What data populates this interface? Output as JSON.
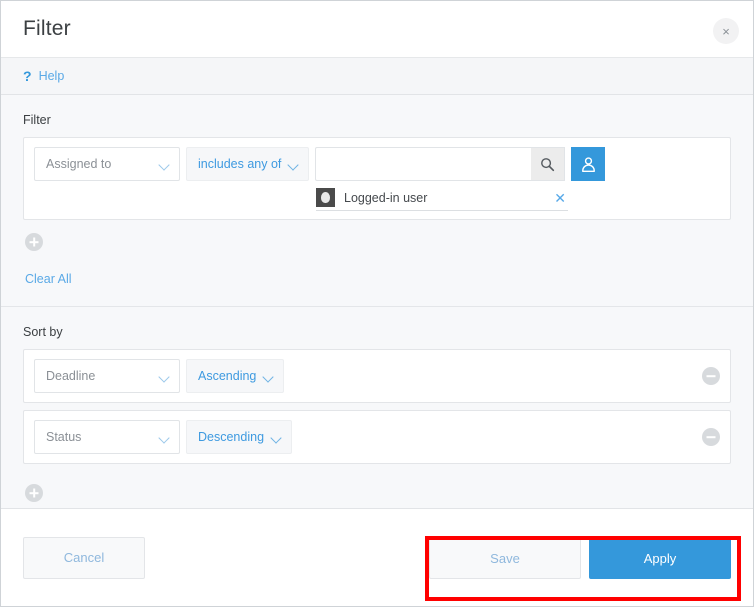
{
  "header": {
    "title": "Filter",
    "close_label": "×"
  },
  "help": {
    "marker": "?",
    "label": "Help"
  },
  "filter_section": {
    "label": "Filter",
    "rows": [
      {
        "field": "Assigned to",
        "operator": "includes any of",
        "search_value": "",
        "search_placeholder": "",
        "chips": [
          {
            "label": "Logged-in user",
            "remove_label": "✕"
          }
        ]
      }
    ],
    "add_label": "+",
    "clear_all_label": "Clear All"
  },
  "sort_section": {
    "label": "Sort by",
    "rows": [
      {
        "field": "Deadline",
        "direction": "Ascending",
        "remove_label": "−"
      },
      {
        "field": "Status",
        "direction": "Descending",
        "remove_label": "−"
      }
    ],
    "add_label": "+"
  },
  "footer": {
    "cancel_label": "Cancel",
    "save_label": "Save",
    "apply_label": "Apply"
  },
  "colors": {
    "accent_blue": "#3498db",
    "link_blue": "#5aa9e6",
    "highlight_red": "#ff0000",
    "panel_bg": "#f7f8fa",
    "card_bg": "#ffffff"
  }
}
